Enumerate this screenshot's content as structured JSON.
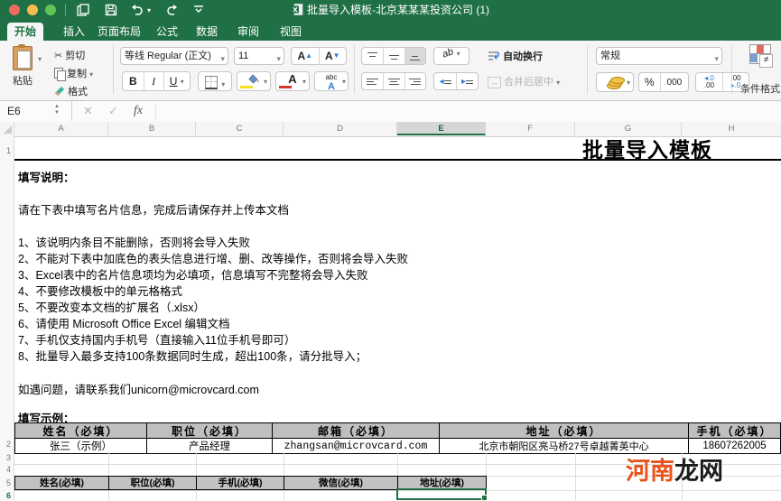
{
  "titlebar": {
    "title": "批量导入模板-北京某某某投资公司 (1)"
  },
  "tabs": {
    "home": "开始",
    "insert": "插入",
    "layout": "页面布局",
    "formulas": "公式",
    "data": "数据",
    "review": "审阅",
    "view": "视图"
  },
  "ribbon": {
    "paste": "粘贴",
    "cut": "剪切",
    "copy": "复制",
    "format_painter": "格式",
    "font_name": "等线 Regular (正文)",
    "font_size": "11",
    "wrap_text": "自动换行",
    "merge_center": "合并后居中",
    "number_format": "常规",
    "conditional_format": "条件格式"
  },
  "glyphs": {
    "caret": "▾",
    "scissors": "✂",
    "bold": "B",
    "italic": "I",
    "underline": "U",
    "letter_a": "A",
    "tri_up": "▲",
    "tri_down": "▼",
    "abc": "abc",
    "orientation": "ab",
    "indent_left": "◂",
    "indent_right": "▸",
    "percent": "%",
    "thousands": "000",
    "dec_inc_top": "◂.0",
    "dec_inc_bot": ".00",
    "dec_dec_top": ".00",
    "dec_dec_bot": "▸.0",
    "not_equal": "≠",
    "merge_arrows": "↔",
    "cancel": "✕",
    "confirm": "✓",
    "fx": "fx",
    "spin_up": "▲",
    "spin_down": "▼"
  },
  "formula_bar": {
    "cell_ref": "E6"
  },
  "sheet": {
    "col_headers": [
      "A",
      "B",
      "C",
      "D",
      "E",
      "F",
      "G",
      "H"
    ],
    "row_headers": [
      "1",
      "2",
      "3",
      "4",
      "5",
      "6"
    ],
    "selected_cell": "E6",
    "title": "批量导入模板",
    "instructions_heading": "填写说明：",
    "intro": "请在下表中填写名片信息，完成后请保存并上传本文档",
    "items": [
      "1、该说明内条目不能删除，否则将会导入失败",
      "2、不能对下表中加底色的表头信息进行增、删、改等操作，否则将会导入失败",
      "3、Excel表中的名片信息项均为必填项，信息填写不完整将会导入失败",
      "4、不要修改模板中的单元格格式",
      "5、不要改变本文档的扩展名（.xlsx）",
      "6、请使用 Microsoft Office Excel 编辑文档",
      "7、手机仅支持国内手机号（直接输入11位手机号即可）",
      "8、批量导入最多支持100条数据同时生成，超出100条，请分批导入；"
    ],
    "contact": "如遇问题，请联系我们unicorn@microvcard.com",
    "example_heading": "填写示例：",
    "table1": {
      "headers": [
        "姓名（必填）",
        "职位（必填）",
        "邮箱（必填）",
        "地址（必填）",
        "手机（必填）"
      ],
      "row": [
        "张三（示例）",
        "产品经理",
        "zhangsan@microvcard.com",
        "北京市朝阳区亮马桥27号卓越菁英中心",
        "18607262005"
      ]
    },
    "table2": {
      "headers": [
        "姓名(必填)",
        "职位(必填)",
        "手机(必填)",
        "微信(必填)",
        "地址(必填)"
      ]
    },
    "watermark": {
      "left": "河南",
      "right": "龙网"
    }
  }
}
